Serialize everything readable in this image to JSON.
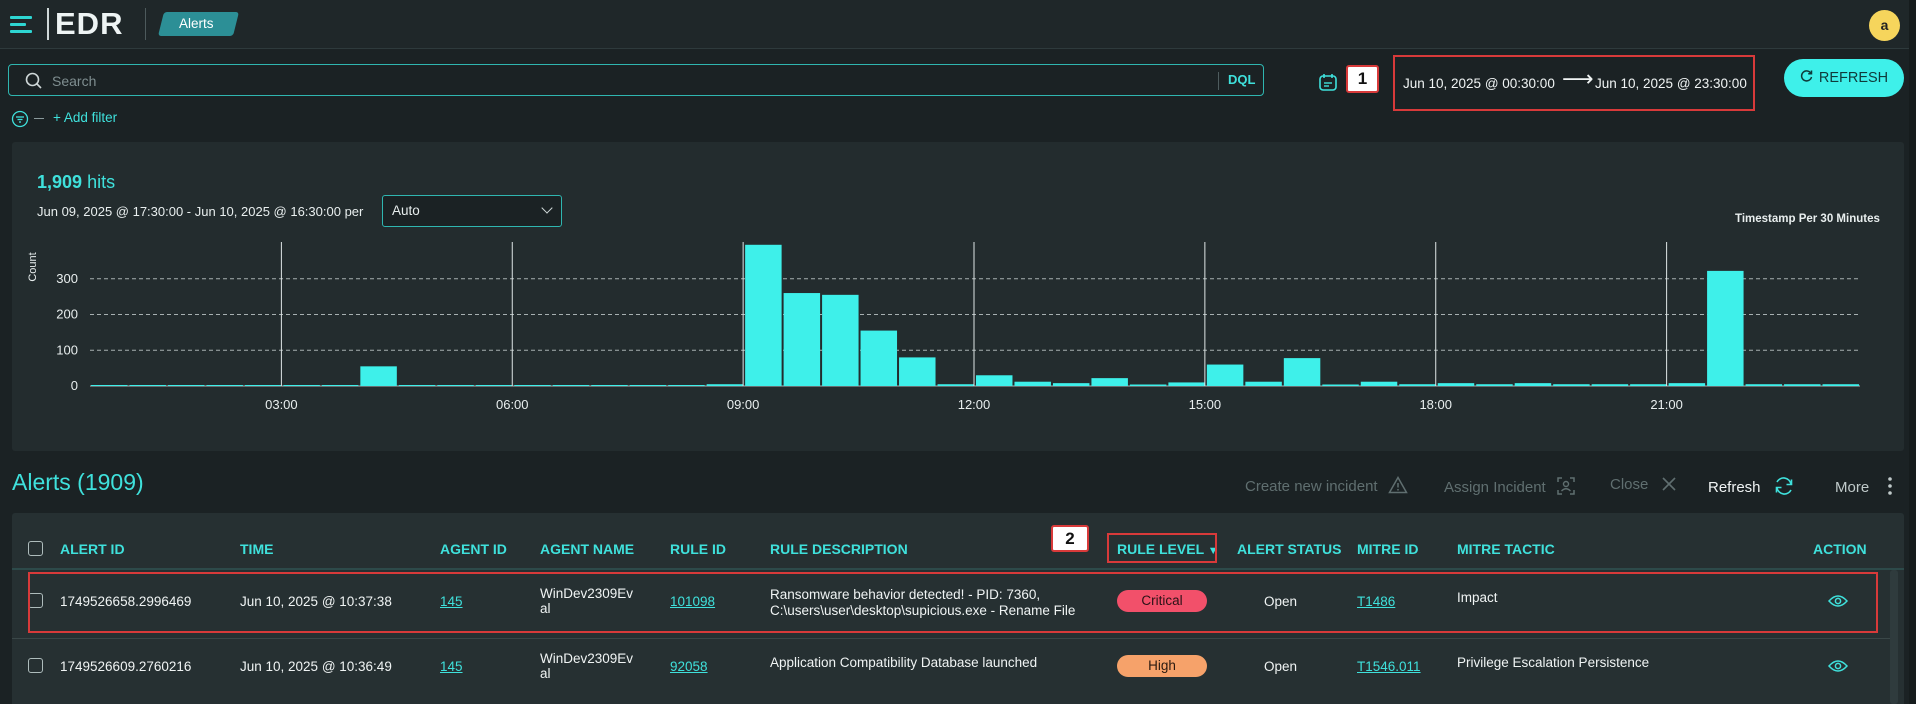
{
  "app": {
    "brand": "EDR",
    "page": "Alerts",
    "avatar_initial": "a"
  },
  "search": {
    "placeholder": "Search",
    "query_language": "DQL",
    "add_filter": "+ Add filter"
  },
  "date_range": {
    "callout": "1",
    "from": "Jun 10, 2025 @ 00:30:00",
    "arrow": "⟶",
    "to": "Jun 10, 2025 @ 23:30:00"
  },
  "refresh_button": {
    "label": "REFRESH",
    "icon": "refresh-icon"
  },
  "histogram": {
    "hits_count": "1,909",
    "hits_label": "hits",
    "range_text": "Jun 09, 2025 @ 17:30:00 - Jun 10, 2025 @ 16:30:00 per",
    "interval": "Auto",
    "timestamp_label": "Timestamp Per 30 Minutes"
  },
  "chart_data": {
    "type": "bar",
    "ylabel": "Count",
    "xlabel": "",
    "ylim": [
      0,
      400
    ],
    "yticks": [
      "300",
      "200",
      "100",
      "0"
    ],
    "xticks": [
      "03:00",
      "06:00",
      "09:00",
      "12:00",
      "15:00",
      "18:00",
      "21:00"
    ],
    "categories": [
      "00:30",
      "01:00",
      "01:30",
      "02:00",
      "02:30",
      "03:00",
      "03:30",
      "04:00",
      "04:30",
      "05:00",
      "05:30",
      "06:00",
      "06:30",
      "07:00",
      "07:30",
      "08:00",
      "08:30",
      "09:00",
      "09:30",
      "10:00",
      "10:30",
      "11:00",
      "11:30",
      "12:00",
      "12:30",
      "13:00",
      "13:30",
      "14:00",
      "14:30",
      "15:00",
      "15:30",
      "16:00",
      "16:30",
      "17:00",
      "17:30",
      "18:00",
      "18:30",
      "19:00",
      "19:30",
      "20:00",
      "20:30",
      "21:00",
      "21:30",
      "22:00",
      "22:30",
      "23:00"
    ],
    "values": [
      0,
      0,
      0,
      0,
      0,
      0,
      0,
      55,
      0,
      0,
      0,
      0,
      0,
      0,
      0,
      0,
      5,
      395,
      260,
      255,
      155,
      80,
      5,
      30,
      12,
      8,
      22,
      3,
      10,
      60,
      12,
      78,
      3,
      12,
      5,
      8,
      5,
      8,
      5,
      5,
      5,
      8,
      322,
      5,
      5,
      5
    ],
    "grid": true
  },
  "alerts": {
    "title": "Alerts (1909)",
    "actions": {
      "create": "Create new incident",
      "assign": "Assign Incident",
      "close": "Close",
      "refresh": "Refresh",
      "more": "More"
    },
    "columns": [
      "ALERT ID",
      "TIME",
      "AGENT ID",
      "AGENT NAME",
      "RULE ID",
      "RULE DESCRIPTION",
      "RULE LEVEL",
      "ALERT STATUS",
      "MITRE ID",
      "MITRE TACTIC",
      "ACTION"
    ],
    "sort_callout": "2",
    "rows": [
      {
        "alert_id": "1749526658.2996469",
        "time": "Jun 10, 2025 @ 10:37:38",
        "agent_id": "145",
        "agent_name_1": "WinDev2309Ev",
        "agent_name_2": "al",
        "rule_id": "101098",
        "desc_1": "Ransomware behavior detected! - PID: 7360,",
        "desc_2": "C:\\users\\user\\desktop\\supicious.exe - Rename File",
        "level": "Critical",
        "level_color": "#f2506a",
        "status": "Open",
        "mitre_id": "T1486",
        "tactic": "Impact"
      },
      {
        "alert_id": "1749526609.2760216",
        "time": "Jun 10, 2025 @ 10:36:49",
        "agent_id": "145",
        "agent_name_1": "WinDev2309Ev",
        "agent_name_2": "al",
        "rule_id": "92058",
        "desc_1": "Application Compatibility Database launched",
        "desc_2": "",
        "level": "High",
        "level_color": "#f6a26a",
        "status": "Open",
        "mitre_id": "T1546.011",
        "tactic": "Privilege Escalation Persistence"
      }
    ]
  }
}
